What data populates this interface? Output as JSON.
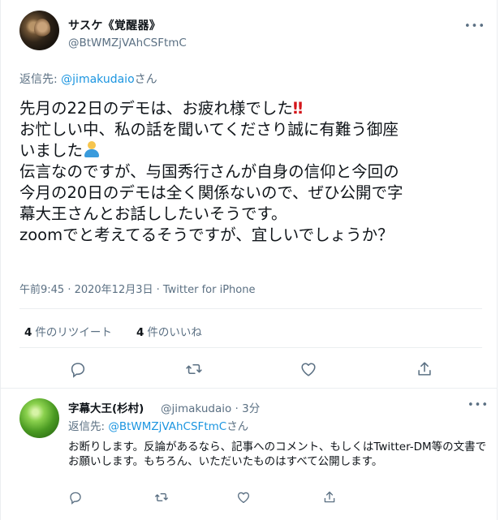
{
  "tweet": {
    "display_name": "サスケ《覚醒器》",
    "handle": "@BtWMZjVAhCSFtmC",
    "more_label": "•••",
    "reply_prefix": "返信先: ",
    "reply_mention": "@jimakudaio",
    "reply_suffix": "さん",
    "text_line1": "先月の22日のデモは、お疲れ様でした",
    "emoji_bang": "‼",
    "text_line2": "お忙しい中、私の話を聞いてくださり誠に有難う御座",
    "text_line3": "いました",
    "text_rest": "伝言なのですが、与国秀行さんが自身の信仰と今回の\n今月の20日のデモは全く関係ないので、ぜひ公開で字\n幕大王さんとお話ししたいそうです。\nzoomでと考えてるそうですが、宜しいでしょうか？",
    "timestamp": "午前9:45 · 2020年12月3日 · ",
    "source": "Twitter for iPhone",
    "retweets_count": "4",
    "retweets_label": "件のリツイート",
    "likes_count": "4",
    "likes_label": "件のいいね",
    "icons": [
      "reply-icon",
      "retweet-icon",
      "like-icon",
      "share-icon"
    ]
  },
  "reply": {
    "display_name": "字幕大王(杉村)",
    "handle_time": "@jimakudaio · 3分",
    "more_label": "•••",
    "reply_prefix": "返信先: ",
    "reply_mention": "@BtWMZjVAhCSFtmC",
    "reply_suffix": "さん",
    "text": "お断りします。反論があるなら、記事へのコメント、もしくはTwitter-DM等の文書でお願いします。もちろん、いただいたものはすべて公開します。",
    "icons": [
      "reply-icon",
      "retweet-icon",
      "like-icon",
      "share-icon"
    ]
  },
  "colors": {
    "accent": "#1b95e0",
    "secondary_text": "#5b7083",
    "divider": "#ebeef0"
  }
}
